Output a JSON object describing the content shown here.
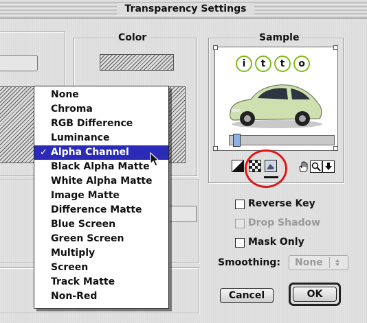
{
  "window": {
    "title": "Transparency Settings"
  },
  "groups": {
    "color_label": "Color",
    "sample_label": "Sample"
  },
  "menu": {
    "items": [
      "None",
      "Chroma",
      "RGB Difference",
      "Luminance",
      "Alpha Channel",
      "Black Alpha Matte",
      "White Alpha Matte",
      "Image Matte",
      "Difference Matte",
      "Blue Screen",
      "Green Screen",
      "Multiply",
      "Screen",
      "Track Matte",
      "Non-Red"
    ],
    "selected": "Alpha Channel",
    "check_mark": "✓"
  },
  "sample": {
    "logo_letters": [
      "i",
      "t",
      "t",
      "o"
    ],
    "slider_value": 0.03
  },
  "view_buttons": [
    "black-white-icon",
    "checkerboard-icon",
    "image-matte-icon"
  ],
  "tools": [
    "hand-icon",
    "zoom-icon",
    "dropdown-arrow-icon"
  ],
  "options": {
    "reverse_key": "Reverse Key",
    "drop_shadow": "Drop Shadow",
    "mask_only": "Mask Only"
  },
  "smoothing": {
    "label": "Smoothing:",
    "value": "None"
  },
  "buttons": {
    "cancel": "Cancel",
    "ok": "OK"
  },
  "colors": {
    "selection": "#2b2bb7",
    "highlight_circle": "#e01515",
    "logo_green": "#7cbb1a"
  }
}
